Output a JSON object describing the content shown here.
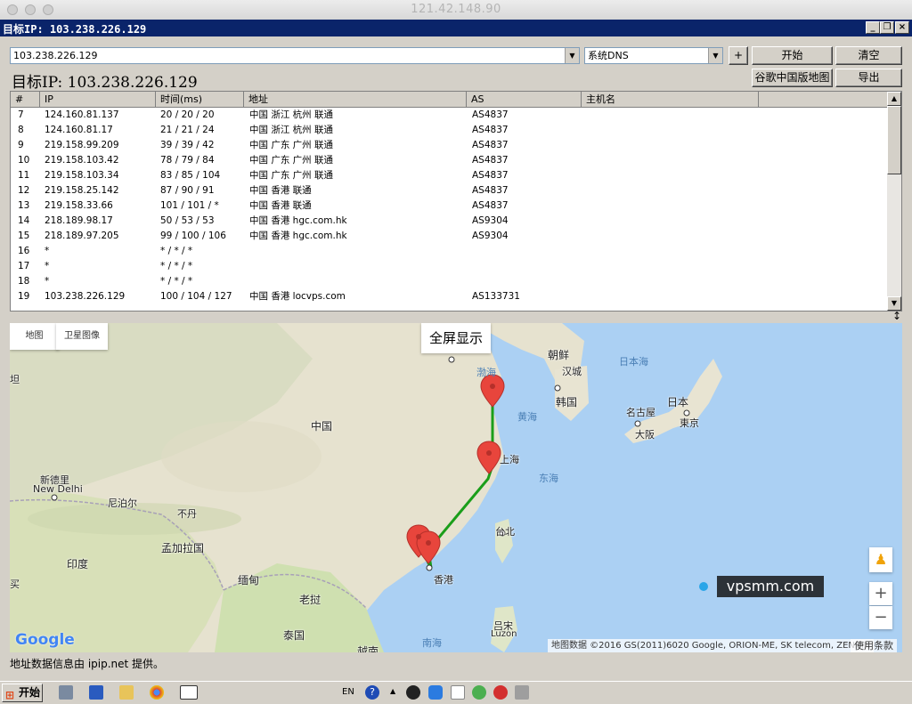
{
  "window": {
    "host_title": "121.42.148.90",
    "app_title": "目标IP: 103.238.226.129"
  },
  "toolbar": {
    "ip_input_value": "103.238.226.129",
    "dns_select_value": "系统DNS",
    "plus_label": "+",
    "start_label": "开始",
    "clear_label": "清空",
    "google_map_label": "谷歌中国版地图",
    "export_label": "导出"
  },
  "target_ip_heading": "目标IP: 103.238.226.129",
  "table": {
    "columns": [
      "#",
      "IP",
      "时间(ms)",
      "地址",
      "AS",
      "主机名"
    ],
    "rows": [
      {
        "n": "7",
        "ip": "124.160.81.137",
        "time": "20 / 20 / 20",
        "addr": "中国 浙江 杭州 联通",
        "as": "AS4837",
        "host": ""
      },
      {
        "n": "8",
        "ip": "124.160.81.17",
        "time": "21 / 21 / 24",
        "addr": "中国 浙江 杭州 联通",
        "as": "AS4837",
        "host": ""
      },
      {
        "n": "9",
        "ip": "219.158.99.209",
        "time": "39 / 39 / 42",
        "addr": "中国 广东 广州 联通",
        "as": "AS4837",
        "host": ""
      },
      {
        "n": "10",
        "ip": "219.158.103.42",
        "time": "78 / 79 / 84",
        "addr": "中国 广东 广州 联通",
        "as": "AS4837",
        "host": ""
      },
      {
        "n": "11",
        "ip": "219.158.103.34",
        "time": "83 / 85 / 104",
        "addr": "中国 广东 广州 联通",
        "as": "AS4837",
        "host": ""
      },
      {
        "n": "12",
        "ip": "219.158.25.142",
        "time": "87 / 90 / 91",
        "addr": "中国 香港 联通",
        "as": "AS4837",
        "host": ""
      },
      {
        "n": "13",
        "ip": "219.158.33.66",
        "time": "101 / 101 / *",
        "addr": "中国 香港 联通",
        "as": "AS4837",
        "host": ""
      },
      {
        "n": "14",
        "ip": "218.189.98.17",
        "time": "50 / 53 / 53",
        "addr": "中国 香港 hgc.com.hk",
        "as": "AS9304",
        "host": ""
      },
      {
        "n": "15",
        "ip": "218.189.97.205",
        "time": "99 / 100 / 106",
        "addr": "中国 香港 hgc.com.hk",
        "as": "AS9304",
        "host": ""
      },
      {
        "n": "16",
        "ip": "*",
        "time": "* / * / *",
        "addr": "",
        "as": "",
        "host": ""
      },
      {
        "n": "17",
        "ip": "*",
        "time": "* / * / *",
        "addr": "",
        "as": "",
        "host": ""
      },
      {
        "n": "18",
        "ip": "*",
        "time": "* / * / *",
        "addr": "",
        "as": "",
        "host": ""
      },
      {
        "n": "19",
        "ip": "103.238.226.129",
        "time": "100 / 104 / 127",
        "addr": "中国 香港 locvps.com",
        "as": "AS133731",
        "host": ""
      }
    ]
  },
  "map": {
    "tab_map": "地图",
    "tab_satellite": "卫星图像",
    "fullscreen": "全屏显示",
    "zoom_in": "+",
    "zoom_out": "−",
    "attribution": "地图数据 ©2016 GS(2011)6020 Google, ORION-ME, SK telecom, ZENRIN",
    "terms": "使用条款",
    "watermark": "vpsmm.com",
    "google_logo": "Google",
    "labels": {
      "china": "中国",
      "newdelhi_cn": "新德里",
      "newdelhi_en": "New Delhi",
      "nepal": "尼泊尔",
      "bhutan": "不丹",
      "bangladesh": "孟加拉国",
      "india": "印度",
      "myanmar": "缅甸",
      "laos": "老挝",
      "thailand": "泰国",
      "vietnam": "越南",
      "north_korea": "朝鲜",
      "seoul": "汉城",
      "south_korea": "韩国",
      "japan": "日本",
      "nagoya": "名古屋",
      "tokyo": "東京",
      "osaka": "大阪",
      "sea_of_japan": "日本海",
      "yellow_sea": "黄海",
      "east_sea": "东海",
      "south_sea": "南海",
      "bohai": "渤海",
      "shanghai": "上海",
      "taipei": "台北",
      "hongkong": "香港",
      "luzon_cn": "吕宋",
      "luzon_en": "Luzon",
      "tajik": "坦",
      "karachi": "买"
    }
  },
  "status_text": "地址数据信息由 ipip.net 提供。",
  "taskbar": {
    "start_label": "开始",
    "lang": "EN"
  },
  "colors": {
    "title_bar": "#0a246a",
    "route_line": "#1a9e1a",
    "marker": "#e8453c"
  }
}
